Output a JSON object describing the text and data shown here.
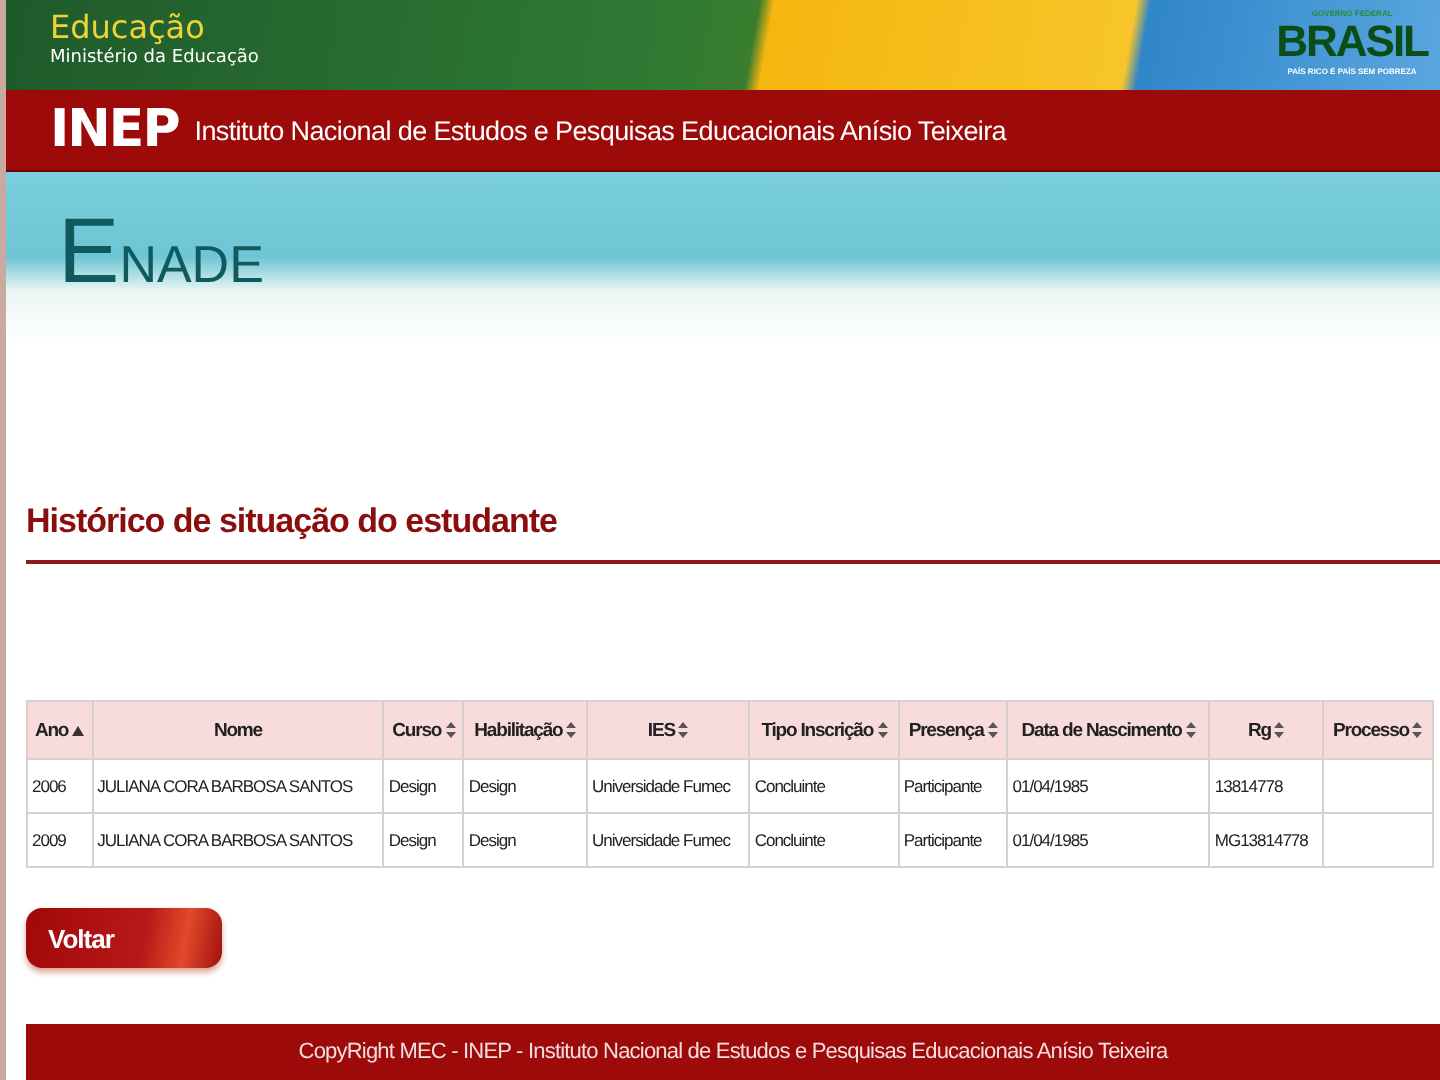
{
  "top_banner": {
    "ministry": "Educação",
    "ministry_sub": "Ministério da Educação",
    "brand_top": "GOVERNO FEDERAL",
    "brand": "BRASIL",
    "brand_slogan": "PAÍS RICO É PAÍS SEM POBREZA"
  },
  "institute_bar": {
    "logo": "INEP",
    "name": "Instituto Nacional de Estudos e Pesquisas Educacionais Anísio Teixeira"
  },
  "product_banner": {
    "title": "ENADE"
  },
  "page_title": "Histórico de situação do estudante",
  "table": {
    "columns": [
      {
        "label": "Ano",
        "sorted": true
      },
      {
        "label": "Nome",
        "sorted": false,
        "sortable": false
      },
      {
        "label": "Curso",
        "sorted": false
      },
      {
        "label": "Habilitação",
        "sorted": false
      },
      {
        "label": "IES",
        "sorted": false
      },
      {
        "label": "Tipo Inscrição",
        "sorted": false
      },
      {
        "label": "Presença",
        "sorted": false
      },
      {
        "label": "Data de Nascimento",
        "sorted": false
      },
      {
        "label": "Rg",
        "sorted": false
      },
      {
        "label": "Processo",
        "sorted": false
      }
    ],
    "rows": [
      [
        "2006",
        "JULIANA CORA BARBOSA SANTOS",
        "Design",
        "Design",
        "Universidade Fumec",
        "Concluinte",
        "Participante",
        "01/04/1985",
        "13814778",
        ""
      ],
      [
        "2009",
        "JULIANA CORA BARBOSA SANTOS",
        "Design",
        "Design",
        "Universidade Fumec",
        "Concluinte",
        "Participante",
        "01/04/1985",
        "MG13814778",
        ""
      ]
    ]
  },
  "back_button": "Voltar",
  "footer": "CopyRight MEC - INEP - Instituto Nacional de Estudos e Pesquisas Educacionais Anísio Teixeira"
}
